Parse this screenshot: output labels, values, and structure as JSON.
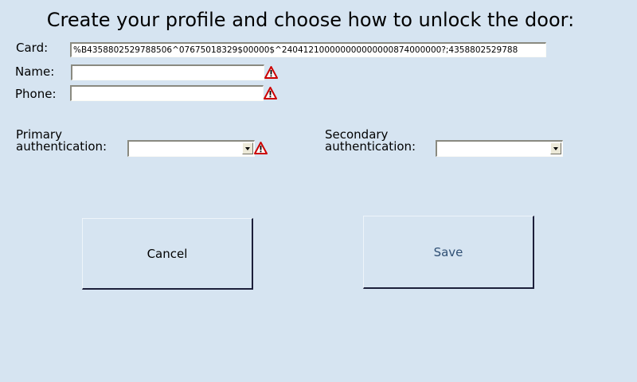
{
  "title": "Create your profile and choose how to unlock the door:",
  "form": {
    "card_label": "Card:",
    "card_value": "%B4358802529788506^07675018329$00000$^240412100000000000000874000000?;4358802529788",
    "name_label": "Name:",
    "name_value": "",
    "phone_label": "Phone:",
    "phone_value": "",
    "primary_auth_label_line1": "Primary",
    "primary_auth_label_line2": "authentication:",
    "primary_auth_value": "",
    "secondary_auth_label_line1": "Secondary",
    "secondary_auth_label_line2": "authentication:",
    "secondary_auth_value": ""
  },
  "buttons": {
    "cancel_label": "Cancel",
    "save_label": "Save"
  },
  "icons": {
    "name_warning": "warning-icon",
    "phone_warning": "warning-icon",
    "primary_auth_warning": "warning-icon"
  },
  "colors": {
    "background": "#d6e4f1",
    "warning": "#cc0000",
    "save_text": "#2f4f74"
  }
}
